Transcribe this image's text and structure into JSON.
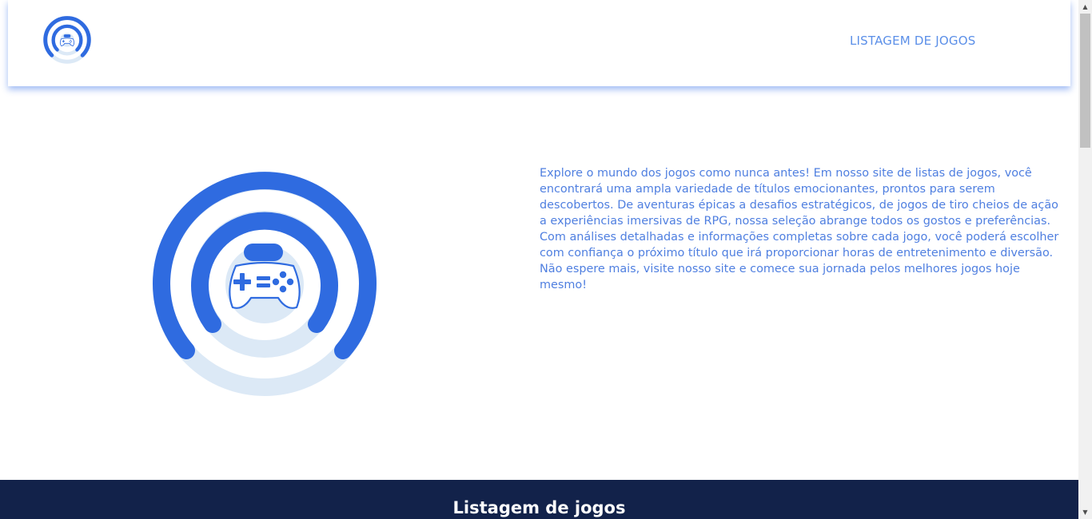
{
  "header": {
    "nav_link": "LISTAGEM DE JOGOS"
  },
  "hero": {
    "description": "Explore o mundo dos jogos como nunca antes! Em nosso site de listas de jogos, você encontrará uma ampla variedade de títulos emocionantes, prontos para serem descobertos. De aventuras épicas a desafios estratégicos, de jogos de tiro cheios de ação a experiências imersivas de RPG, nossa seleção abrange todos os gostos e preferências. Com análises detalhadas e informações completas sobre cada jogo, você poderá escolher com confiança o próximo título que irá proporcionar horas de entretenimento e diversão. Não espere mais, visite nosso site e comece sua jornada pelos melhores jogos hoje mesmo!"
  },
  "section": {
    "title": "Listagem de jogos"
  },
  "icons": {
    "logo": "gamepad-rings-logo-icon",
    "hero_art": "gamepad-rings-illustration-icon",
    "scroll_up": "arrow-up-icon",
    "scroll_down": "arrow-down-icon"
  },
  "colors": {
    "accent": "#2f6be0",
    "accent_light": "#dce9f6",
    "text_blue": "#4f7fe0",
    "nav_blue": "#5b8fe8",
    "band_navy": "#12224a"
  }
}
